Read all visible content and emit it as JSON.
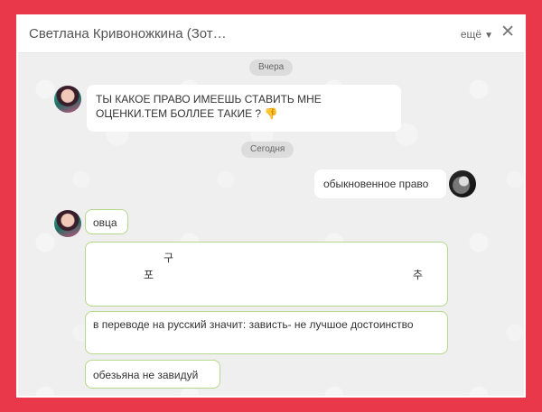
{
  "header": {
    "title": "Светлана Кривоножкина (Зот…",
    "more_label": "ещё",
    "more_arrow": "▼",
    "close_glyph": "✕"
  },
  "chat": {
    "date_yesterday": "Вчера",
    "date_today": "Сегодня",
    "messages": [
      {
        "text": "ТЫ КАКОЕ ПРАВО ИМЕЕШЬ СТАВИТЬ МНЕ ОЦЕНКИ.ТЕМ БОЛЛЕЕ ТАКИЕ ?",
        "emoji": "👎"
      },
      {
        "text": "обыкновенное право"
      },
      {
        "text": "овца"
      },
      {
        "chars": [
          "구",
          "포",
          "추"
        ]
      },
      {
        "text": "в переводе на русский  значит: зависть- не лучшое достоинство"
      },
      {
        "text": "обезьяна  не завидуй"
      }
    ]
  },
  "colors": {
    "background": "#e8384a",
    "chat_bg": "#efefef",
    "bubble_border": "#b6d88a"
  }
}
